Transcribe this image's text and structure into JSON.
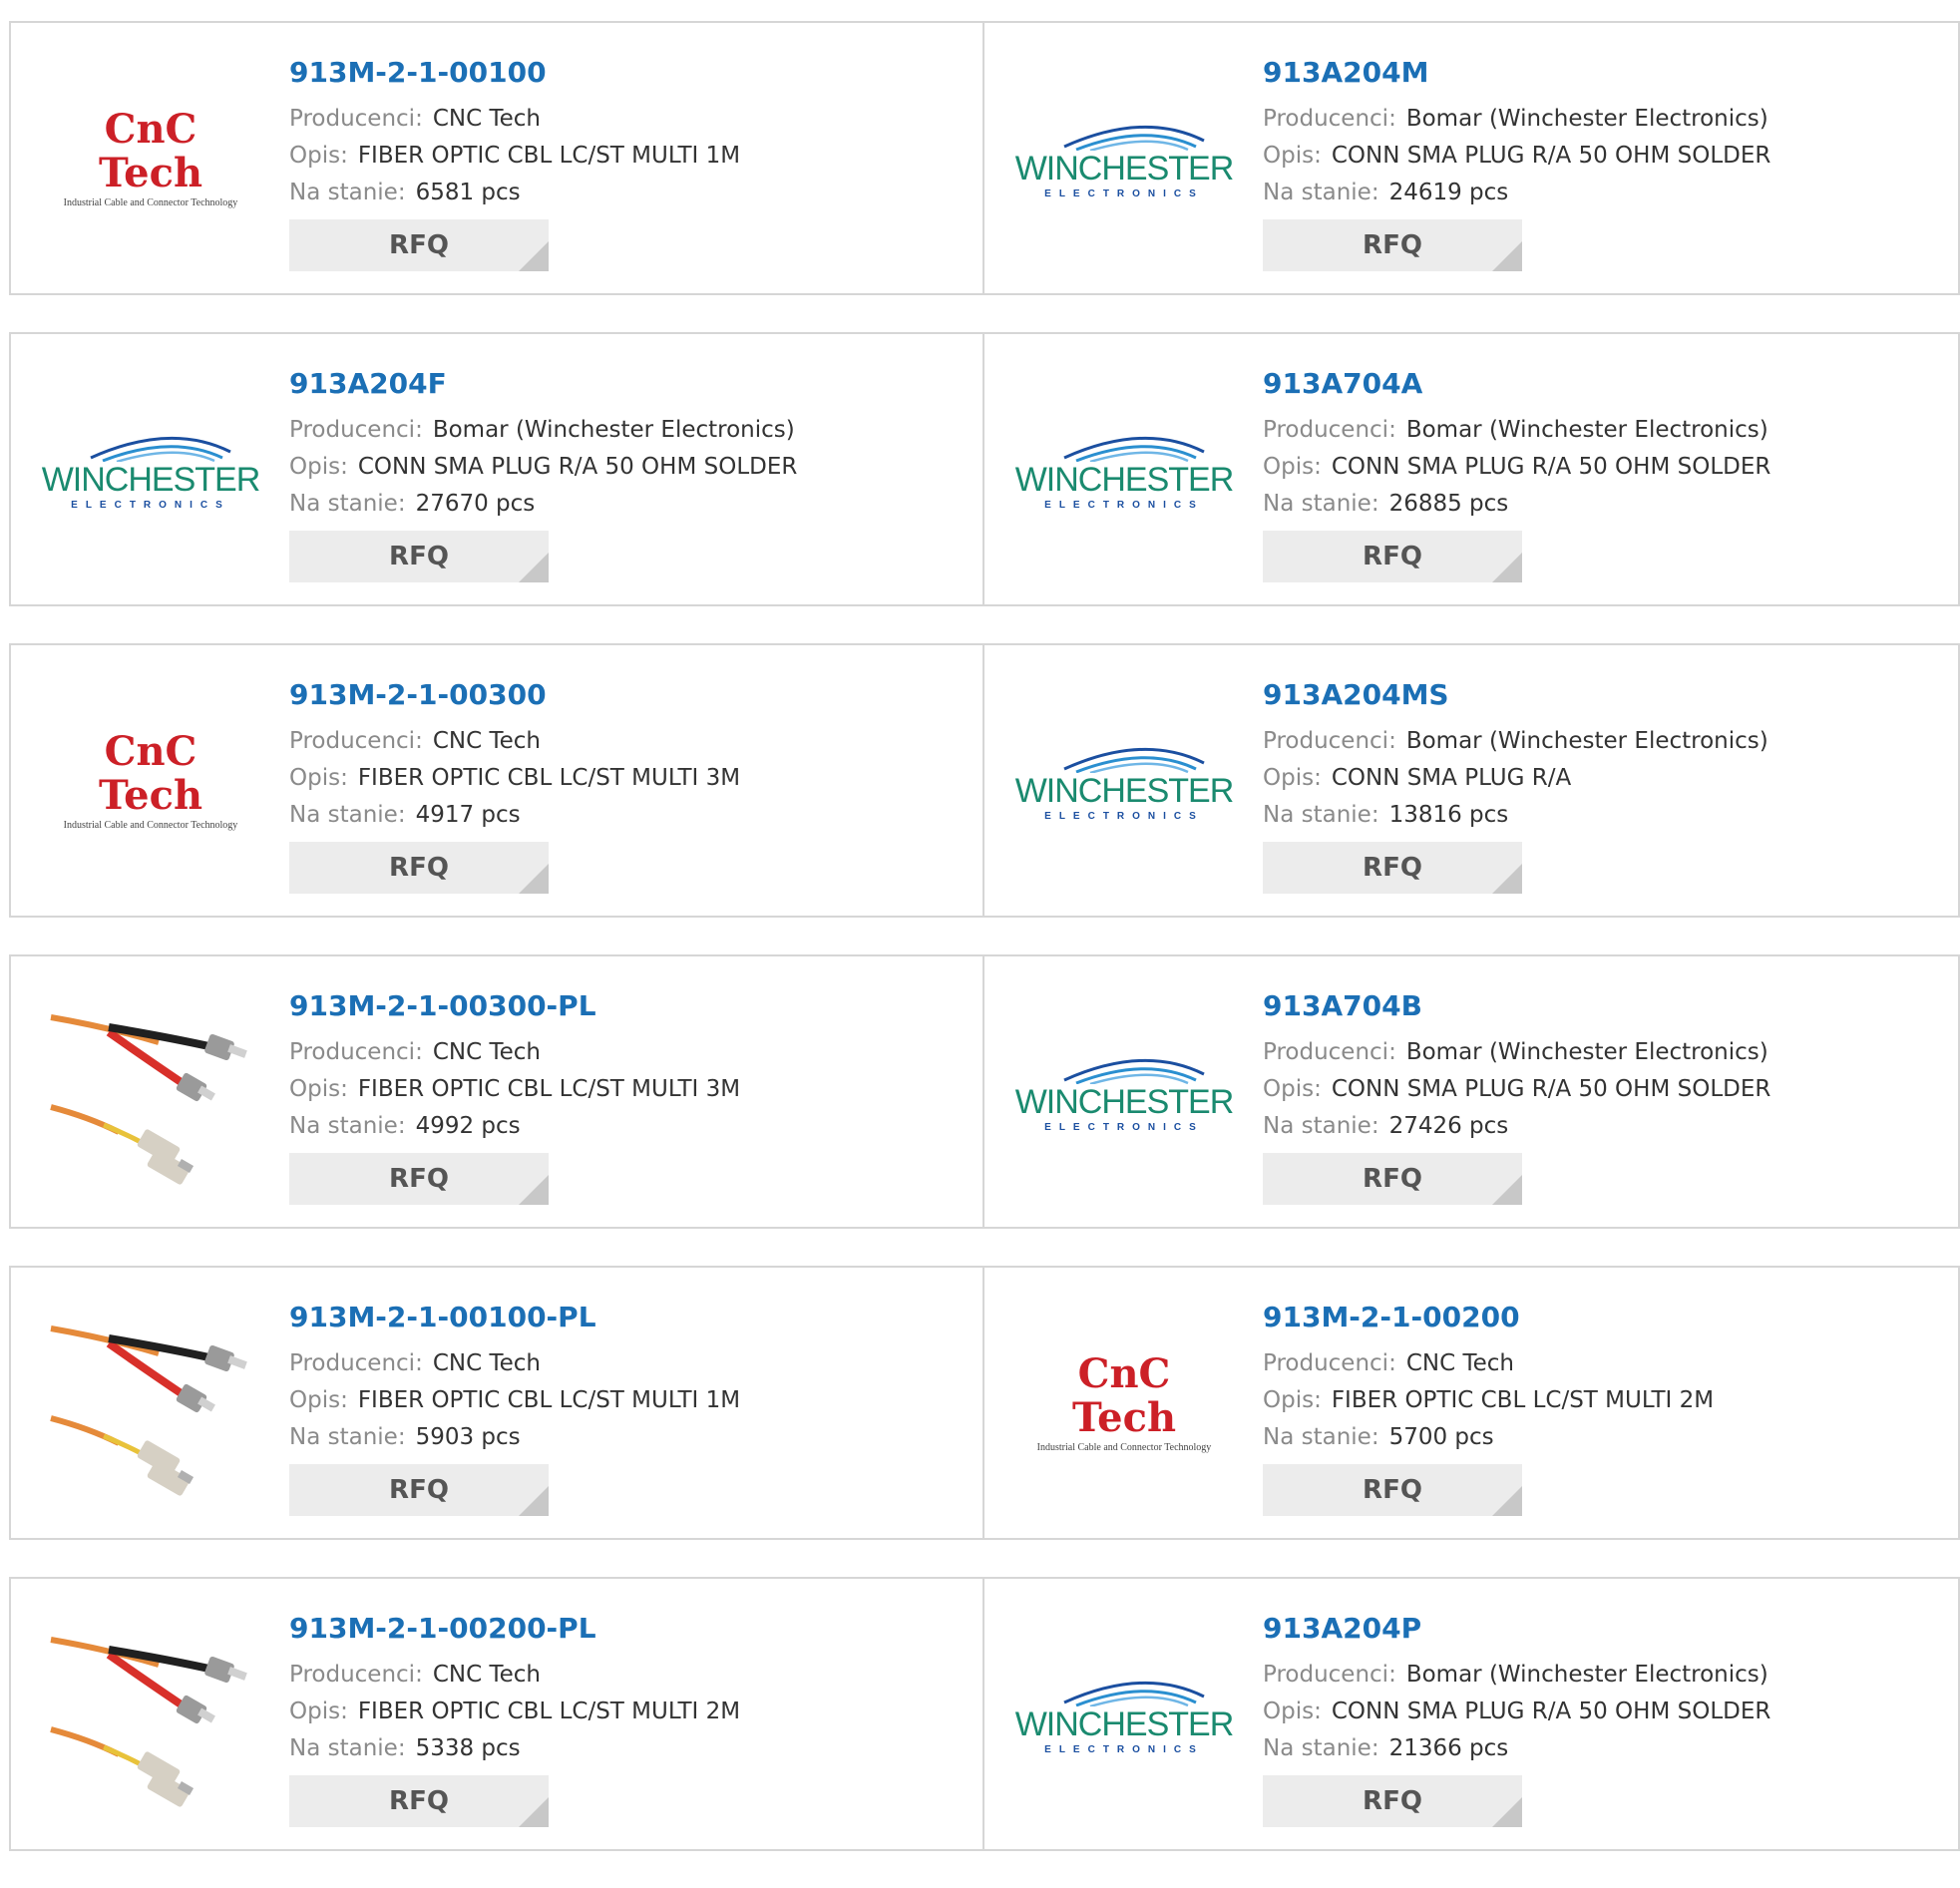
{
  "labels": {
    "manufacturer": "Producenci:",
    "description": "Opis:",
    "stock": "Na stanie:",
    "rfq": "RFQ"
  },
  "logos": {
    "cnc": {
      "name": "CnC Tech",
      "tagline": "Industrial Cable and Connector Technology"
    },
    "winchester": {
      "name": "WINCHESTER",
      "tagline": "ELECTRONICS"
    }
  },
  "colors": {
    "part_number": "#1b6fb5",
    "label": "#8a8a8a",
    "border": "#d6d6d6",
    "button_bg": "#ececec",
    "cnc_red": "#cc2027",
    "winchester_green": "#1a8a6f"
  },
  "rows": [
    {
      "left": {
        "part": "913M-2-1-00100",
        "logo": "cnc",
        "manufacturer": "CNC Tech",
        "description": "FIBER OPTIC CBL LC/ST MULTI 1M",
        "stock": "6581 pcs"
      },
      "right": {
        "part": "913A204M",
        "logo": "winchester",
        "manufacturer": "Bomar (Winchester Electronics)",
        "description": "CONN SMA PLUG R/A 50 OHM SOLDER",
        "stock": "24619 pcs"
      }
    },
    {
      "left": {
        "part": "913A204F",
        "logo": "winchester",
        "manufacturer": "Bomar (Winchester Electronics)",
        "description": "CONN SMA PLUG R/A 50 OHM SOLDER",
        "stock": "27670 pcs"
      },
      "right": {
        "part": "913A704A",
        "logo": "winchester",
        "manufacturer": "Bomar (Winchester Electronics)",
        "description": "CONN SMA PLUG R/A 50 OHM SOLDER",
        "stock": "26885 pcs"
      }
    },
    {
      "left": {
        "part": "913M-2-1-00300",
        "logo": "cnc",
        "manufacturer": "CNC Tech",
        "description": "FIBER OPTIC CBL LC/ST MULTI 3M",
        "stock": "4917 pcs"
      },
      "right": {
        "part": "913A204MS",
        "logo": "winchester",
        "manufacturer": "Bomar (Winchester Electronics)",
        "description": "CONN SMA PLUG R/A",
        "stock": "13816 pcs"
      }
    },
    {
      "left": {
        "part": "913M-2-1-00300-PL",
        "logo": "cable",
        "manufacturer": "CNC Tech",
        "description": "FIBER OPTIC CBL LC/ST MULTI 3M",
        "stock": "4992 pcs"
      },
      "right": {
        "part": "913A704B",
        "logo": "winchester",
        "manufacturer": "Bomar (Winchester Electronics)",
        "description": "CONN SMA PLUG R/A 50 OHM SOLDER",
        "stock": "27426 pcs"
      }
    },
    {
      "left": {
        "part": "913M-2-1-00100-PL",
        "logo": "cable",
        "manufacturer": "CNC Tech",
        "description": "FIBER OPTIC CBL LC/ST MULTI 1M",
        "stock": "5903 pcs"
      },
      "right": {
        "part": "913M-2-1-00200",
        "logo": "cnc",
        "manufacturer": "CNC Tech",
        "description": "FIBER OPTIC CBL LC/ST MULTI 2M",
        "stock": "5700 pcs"
      }
    },
    {
      "left": {
        "part": "913M-2-1-00200-PL",
        "logo": "cable",
        "manufacturer": "CNC Tech",
        "description": "FIBER OPTIC CBL LC/ST MULTI 2M",
        "stock": "5338 pcs"
      },
      "right": {
        "part": "913A204P",
        "logo": "winchester",
        "manufacturer": "Bomar (Winchester Electronics)",
        "description": "CONN SMA PLUG R/A 50 OHM SOLDER",
        "stock": "21366 pcs"
      }
    }
  ]
}
